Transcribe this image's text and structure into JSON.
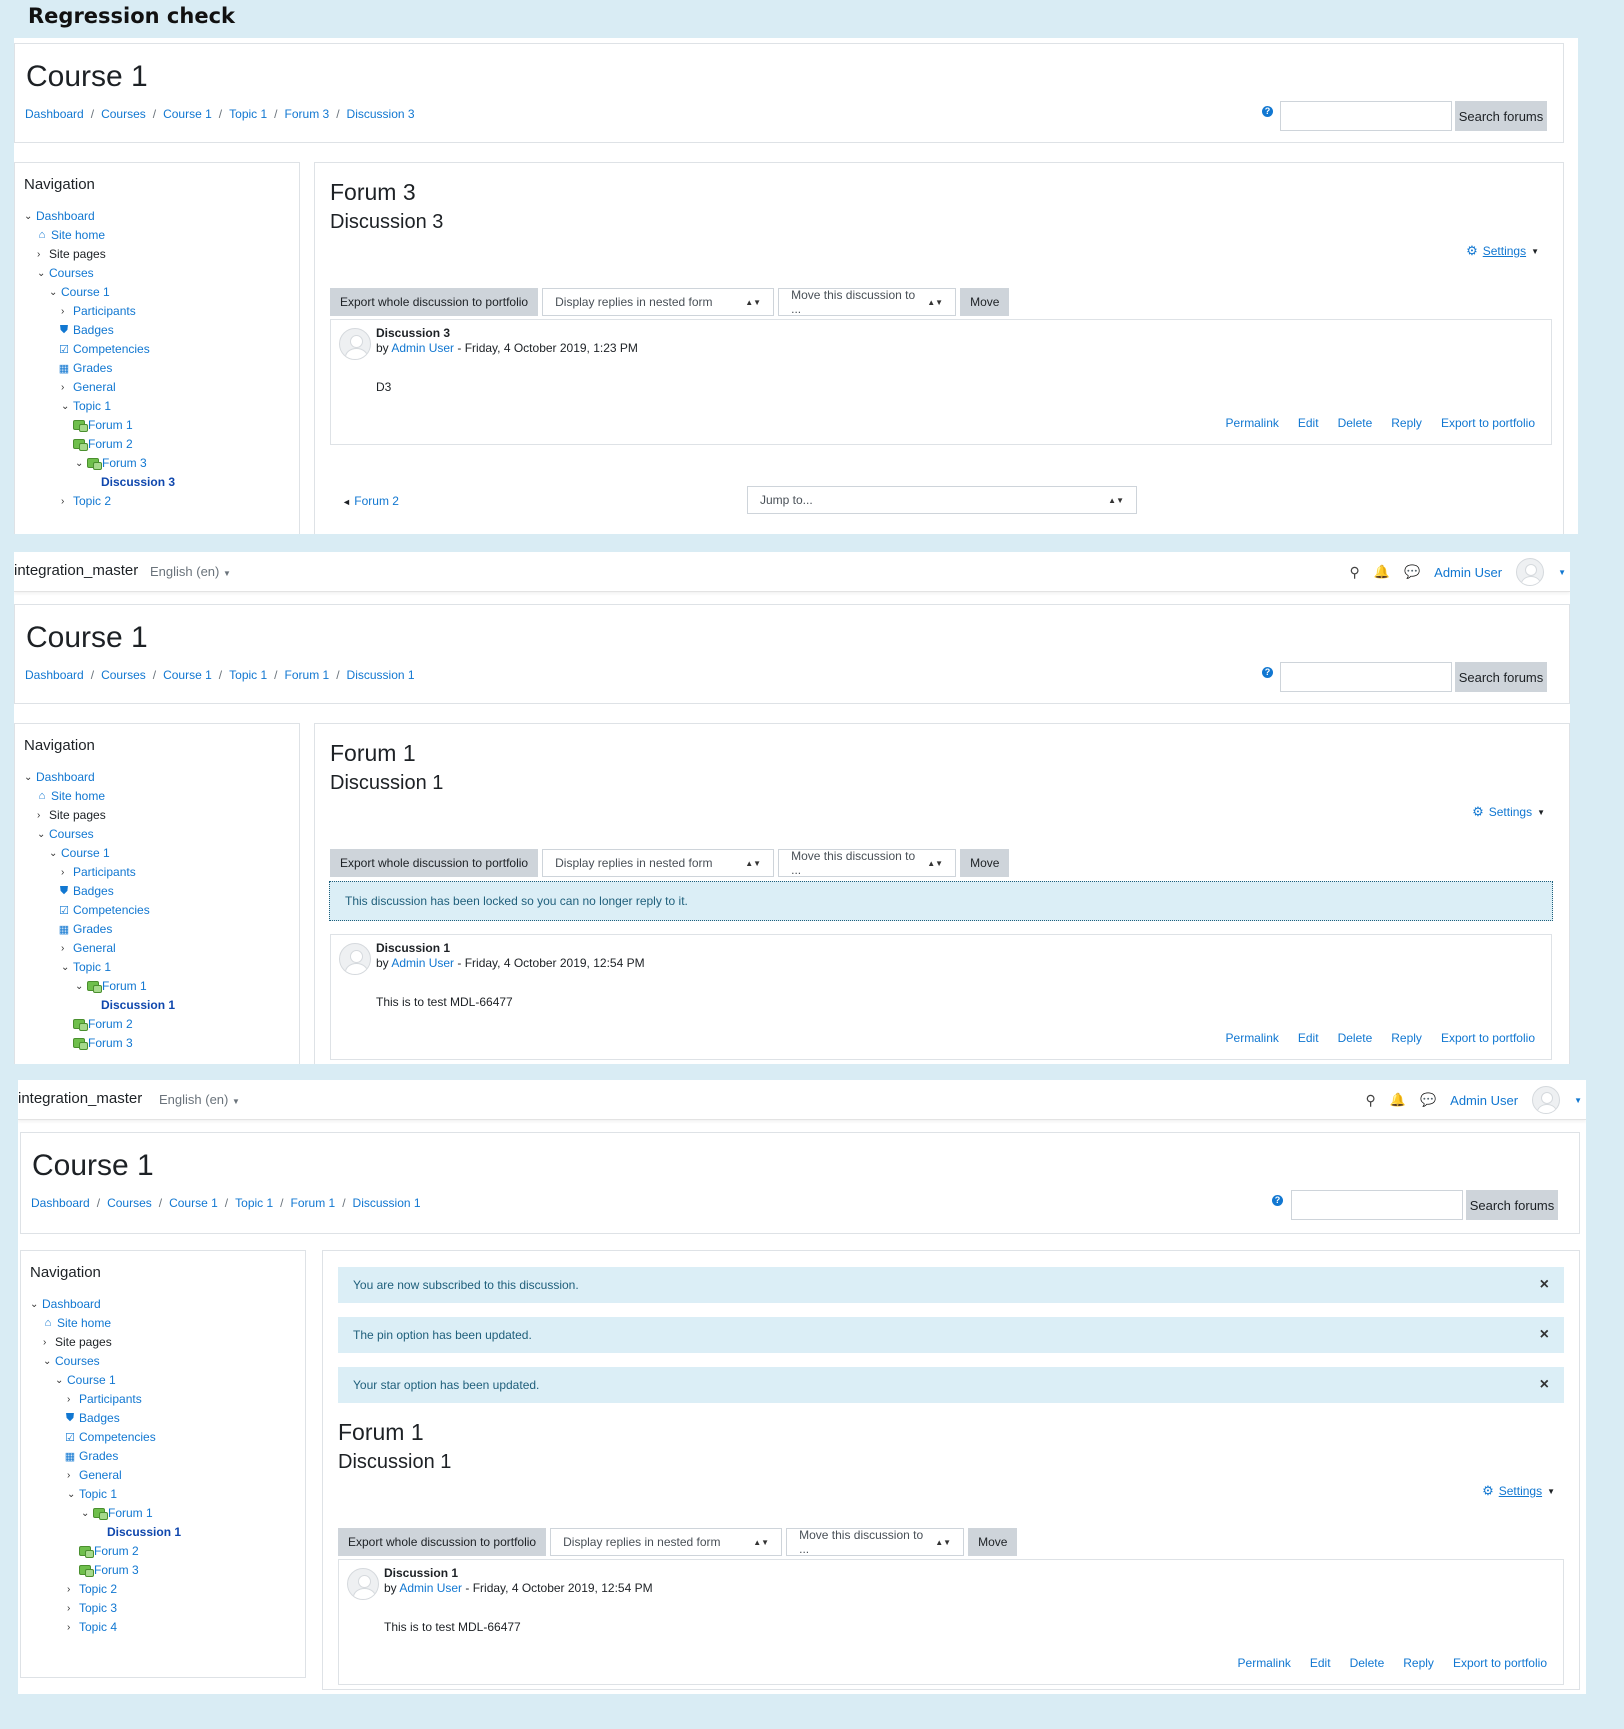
{
  "title": "Regression check",
  "site_name": "integration_master",
  "language": "English (en)",
  "user_name": "Admin User",
  "course_title": "Course 1",
  "search_button": "Search forums",
  "help_icon": "?",
  "navigation_title": "Navigation",
  "settings_label": "Settings",
  "export_discussion": "Export whole discussion to portfolio",
  "display_mode": "Display replies in nested form",
  "move_select": "Move this discussion to ...",
  "move_button": "Move",
  "jump_to": "Jump to...",
  "post_by": "by",
  "post_commands": [
    "Permalink",
    "Edit",
    "Delete",
    "Reply",
    "Export to portfolio"
  ],
  "nav": {
    "dashboard": "Dashboard",
    "site_home": "Site home",
    "site_pages": "Site pages",
    "courses": "Courses",
    "course1": "Course 1",
    "participants": "Participants",
    "badges": "Badges",
    "competencies": "Competencies",
    "grades": "Grades",
    "general": "General",
    "topic1": "Topic 1",
    "forum1": "Forum 1",
    "forum2": "Forum 2",
    "forum3": "Forum 3",
    "discussion1": "Discussion 1",
    "discussion3": "Discussion 3",
    "topic2": "Topic 2",
    "topic3": "Topic 3",
    "topic4": "Topic 4"
  },
  "shot1": {
    "breadcrumb": [
      "Dashboard",
      "Courses",
      "Course 1",
      "Topic 1",
      "Forum 3",
      "Discussion 3"
    ],
    "forum": "Forum 3",
    "discussion": "Discussion 3",
    "post_subject": "Discussion 3",
    "post_author": "Admin User",
    "post_date": "- Friday, 4 October 2019, 1:23 PM",
    "post_body": "D3",
    "prev_link": "Forum 2"
  },
  "shot2": {
    "breadcrumb": [
      "Dashboard",
      "Courses",
      "Course 1",
      "Topic 1",
      "Forum 1",
      "Discussion 1"
    ],
    "forum": "Forum 1",
    "discussion": "Discussion 1",
    "locked_message": "This discussion has been locked so you can no longer reply to it.",
    "post_subject": "Discussion 1",
    "post_author": "Admin User",
    "post_date": "- Friday, 4 October 2019, 12:54 PM",
    "post_body": "This is to test MDL-66477"
  },
  "shot3": {
    "breadcrumb": [
      "Dashboard",
      "Courses",
      "Course 1",
      "Topic 1",
      "Forum 1",
      "Discussion 1"
    ],
    "notifications": [
      "You are now subscribed to this discussion.",
      "The pin option has been updated.",
      "Your star option has been updated."
    ],
    "close_icon": "×",
    "forum": "Forum 1",
    "discussion": "Discussion 1",
    "post_subject": "Discussion 1",
    "post_author": "Admin User",
    "post_date": "- Friday, 4 October 2019, 12:54 PM",
    "post_body": "This is to test MDL-66477"
  }
}
